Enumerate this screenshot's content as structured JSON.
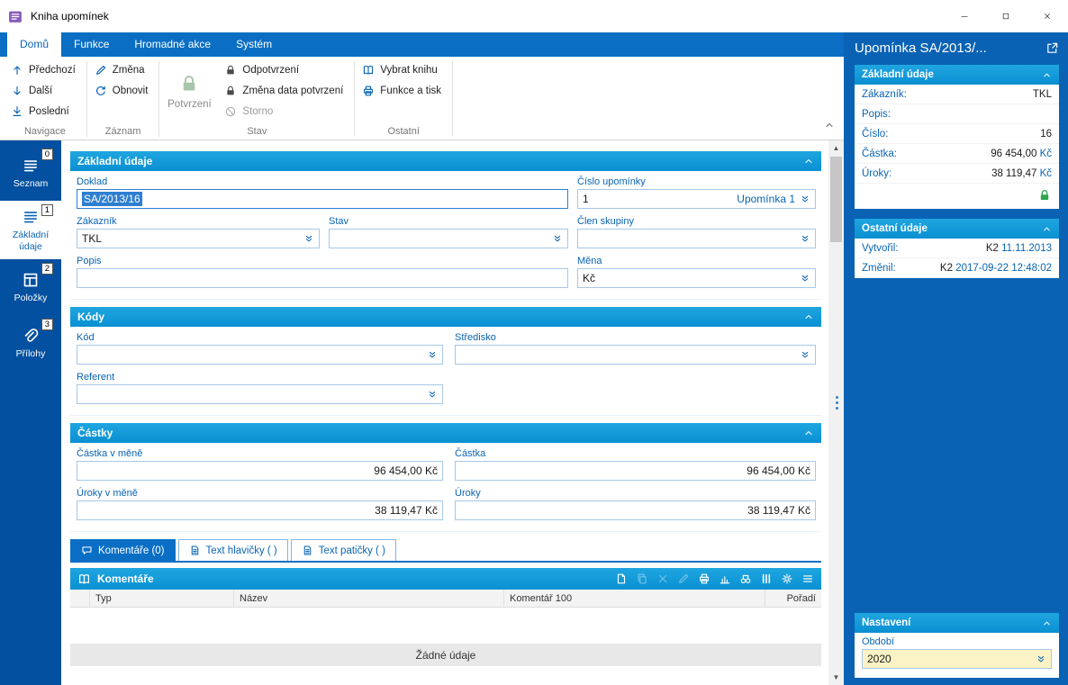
{
  "window": {
    "title": "Kniha upomínek"
  },
  "ribbon": {
    "tabs": [
      "Domů",
      "Funkce",
      "Hromadné akce",
      "Systém"
    ],
    "groups": {
      "navigace": {
        "label": "Navigace",
        "items": [
          "Předchozí",
          "Další",
          "Poslední"
        ]
      },
      "zaznam": {
        "label": "Záznam",
        "items": [
          "Změna",
          "Obnovit"
        ]
      },
      "stav": {
        "label": "Stav",
        "big": "Potvrzení",
        "items": [
          "Odpotvrzení",
          "Změna data potvrzení",
          "Storno"
        ]
      },
      "ostatni": {
        "label": "Ostatní",
        "items": [
          "Vybrat knihu",
          "Funkce a tisk"
        ]
      }
    }
  },
  "sidebar": {
    "items": [
      {
        "label": "Seznam",
        "badge": "0"
      },
      {
        "label": "Základní údaje",
        "badge": "1"
      },
      {
        "label": "Položky",
        "badge": "2"
      },
      {
        "label": "Přílohy",
        "badge": "3"
      }
    ]
  },
  "form": {
    "zakladni": {
      "title": "Základní údaje",
      "doklad_label": "Doklad",
      "doklad_value": "SA/2013/16",
      "cislo_label": "Číslo upomínky",
      "cislo_value": "1",
      "cislo_suffix": "Upomínka 1",
      "zakaznik_label": "Zákazník",
      "zakaznik_value": "TKL",
      "stav_label": "Stav",
      "stav_value": "",
      "clen_label": "Člen skupiny",
      "clen_value": "",
      "popis_label": "Popis",
      "popis_value": "",
      "mena_label": "Měna",
      "mena_value": "Kč"
    },
    "kody": {
      "title": "Kódy",
      "kod_label": "Kód",
      "kod_value": "",
      "stredisko_label": "Středisko",
      "stredisko_value": "",
      "referent_label": "Referent",
      "referent_value": ""
    },
    "castky": {
      "title": "Částky",
      "castka_mena_label": "Částka v měně",
      "castka_mena_value": "96 454,00 Kč",
      "castka_label": "Částka",
      "castka_value": "96 454,00 Kč",
      "uroky_mena_label": "Úroky v měně",
      "uroky_mena_value": "38 119,47 Kč",
      "uroky_label": "Úroky",
      "uroky_value": "38 119,47 Kč"
    }
  },
  "tabs_bottom": [
    "Komentáře (0)",
    "Text hlavičky ( )",
    "Text patičky ( )"
  ],
  "comments": {
    "title": "Komentáře",
    "columns": [
      "Typ",
      "Název",
      "Komentář 100",
      "Pořadí"
    ],
    "empty": "Žádné údaje",
    "toolbar_icons": [
      "new-document",
      "copy",
      "delete",
      "edit",
      "print",
      "chart",
      "search",
      "columns",
      "settings",
      "menu"
    ]
  },
  "preview": {
    "title": "Upomínka SA/2013/...",
    "zakladni": {
      "title": "Základní údaje",
      "rows": [
        {
          "label": "Zákazník:",
          "value": "TKL",
          "extra": ""
        },
        {
          "label": "Popis:",
          "value": "",
          "extra": ""
        },
        {
          "label": "Číslo:",
          "value": "16",
          "extra": ""
        },
        {
          "label": "Částka:",
          "value": "96 454,00",
          "extra": "Kč"
        },
        {
          "label": "Úroky:",
          "value": "38 119,47",
          "extra": "Kč"
        }
      ]
    },
    "ostatni": {
      "title": "Ostatní údaje",
      "rows": [
        {
          "label": "Vytvořil:",
          "value": "K2",
          "extra": "11.11.2013"
        },
        {
          "label": "Změnil:",
          "value": "K2",
          "extra": "2017-09-22 12:48:02"
        }
      ]
    },
    "nastaveni": {
      "title": "Nastavení",
      "obdobi_label": "Období",
      "obdobi_value": "2020"
    }
  }
}
